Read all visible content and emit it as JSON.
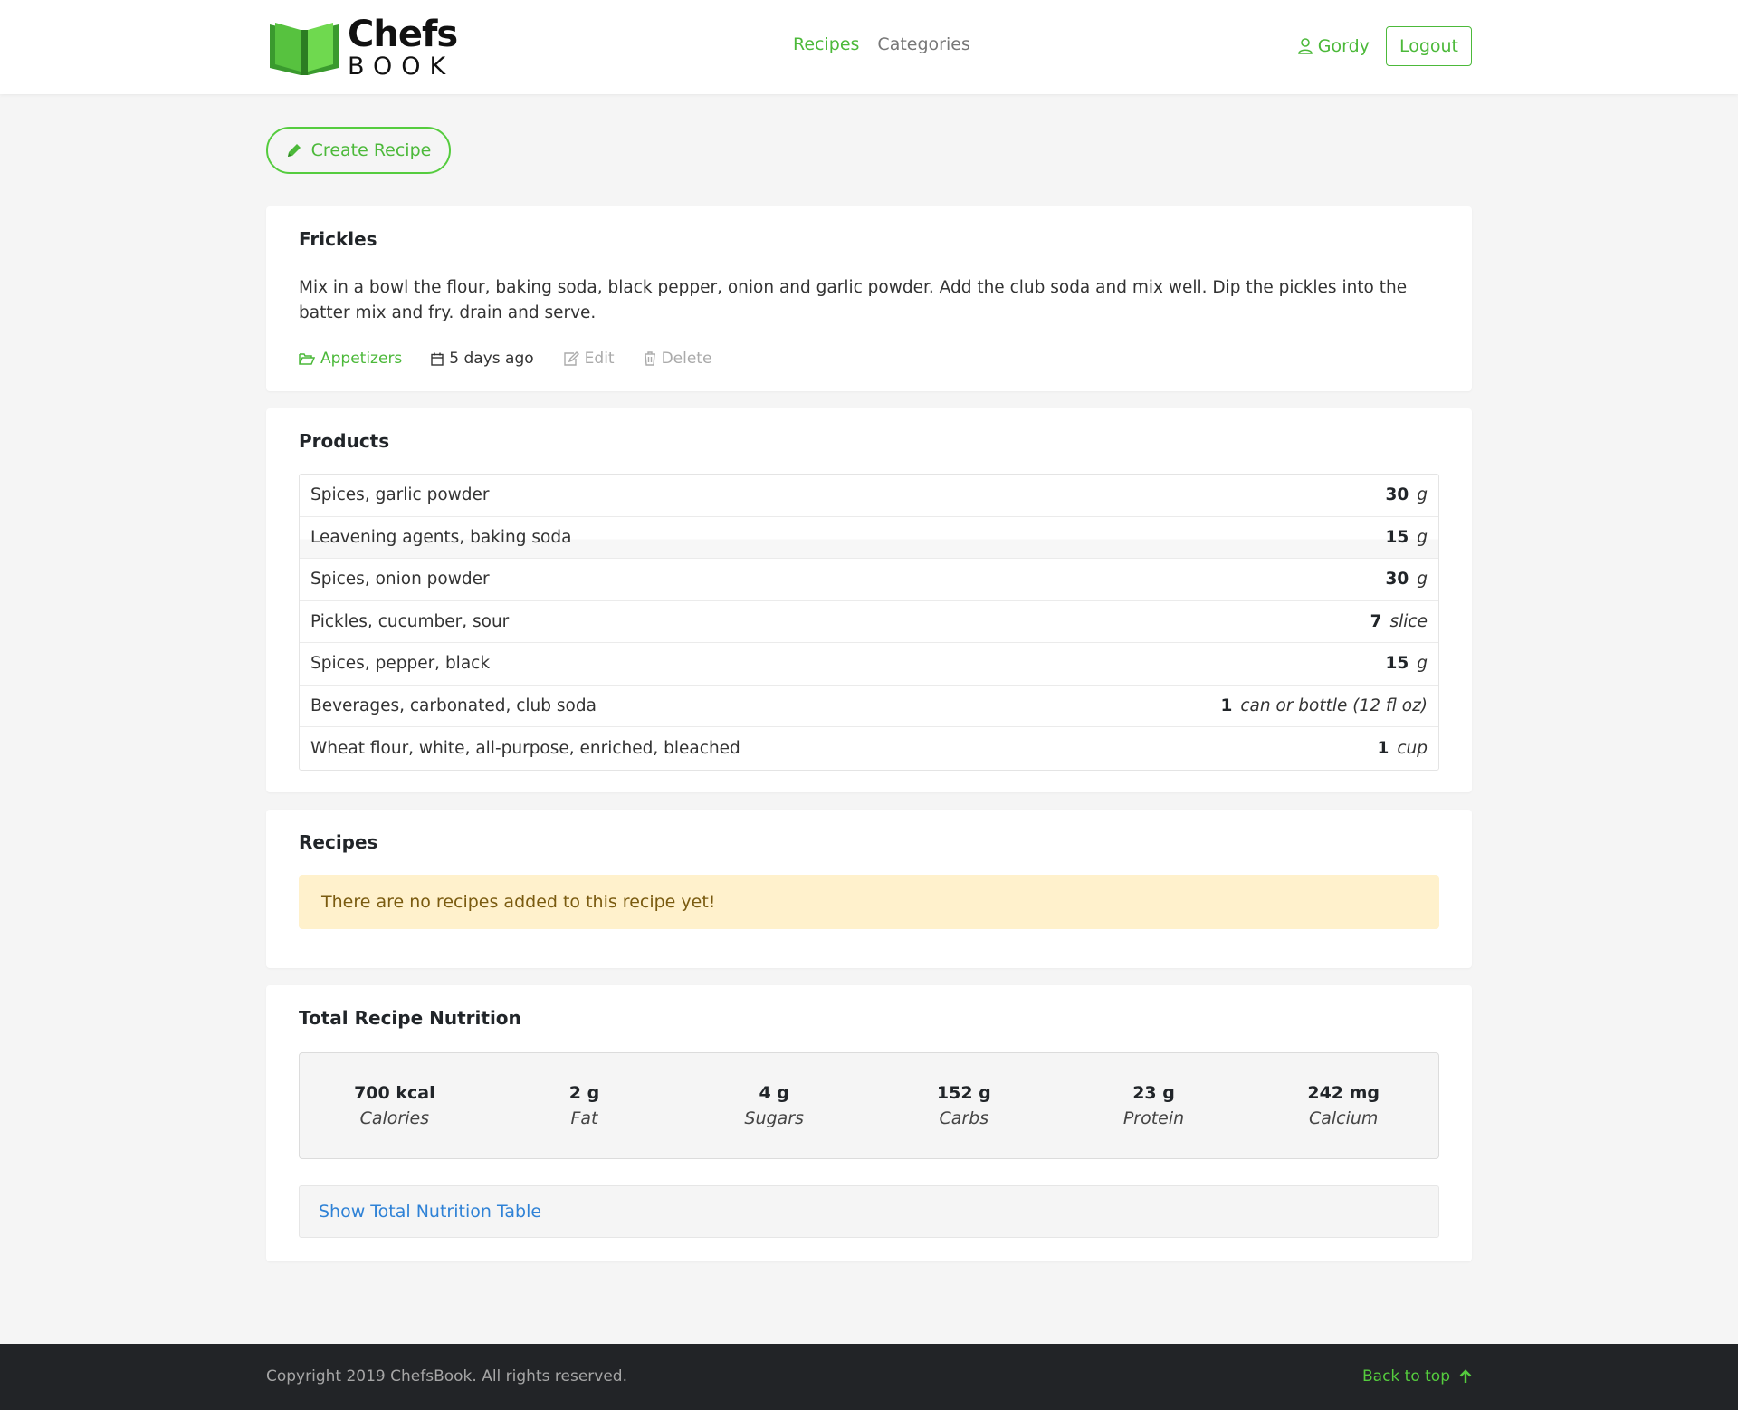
{
  "brand": {
    "name_top": "Chefs",
    "name_bottom": "BOOK",
    "colors": {
      "accent": "#4cb93a",
      "book_dark": "#3a9a2e"
    }
  },
  "nav": {
    "recipes": "Recipes",
    "categories": "Categories"
  },
  "user": {
    "name": "Gordy",
    "logout": "Logout"
  },
  "actions": {
    "create_recipe": "Create Recipe"
  },
  "recipe": {
    "title": "Frickles",
    "description": "Mix in a bowl the flour, baking soda, black pepper, onion and garlic powder. Add the club soda and mix well. Dip the pickles into the batter mix and fry. drain and serve.",
    "category": "Appetizers",
    "created": "5 days ago",
    "edit": "Edit",
    "delete": "Delete"
  },
  "products": {
    "title": "Products",
    "rows": [
      {
        "name": "Spices, garlic powder",
        "qty": "30",
        "unit": "g"
      },
      {
        "name": "Leavening agents, baking soda",
        "qty": "15",
        "unit": "g"
      },
      {
        "name": "Spices, onion powder",
        "qty": "30",
        "unit": "g"
      },
      {
        "name": "Pickles, cucumber, sour",
        "qty": "7",
        "unit": "slice"
      },
      {
        "name": "Spices, pepper, black",
        "qty": "15",
        "unit": "g"
      },
      {
        "name": "Beverages, carbonated, club soda",
        "qty": "1",
        "unit": "can or bottle (12 fl oz)"
      },
      {
        "name": "Wheat flour, white, all-purpose, enriched, bleached",
        "qty": "1",
        "unit": "cup"
      }
    ]
  },
  "recipes_section": {
    "title": "Recipes",
    "empty_message": "There are no recipes added to this recipe yet!"
  },
  "nutrition": {
    "title": "Total Recipe Nutrition",
    "items": [
      {
        "value": "700 kcal",
        "label": "Calories"
      },
      {
        "value": "2 g",
        "label": "Fat"
      },
      {
        "value": "4 g",
        "label": "Sugars"
      },
      {
        "value": "152 g",
        "label": "Carbs"
      },
      {
        "value": "23 g",
        "label": "Protein"
      },
      {
        "value": "242 mg",
        "label": "Calcium"
      }
    ],
    "toggle": "Show Total Nutrition Table"
  },
  "footer": {
    "copyright": "Copyright 2019 ChefsBook. All rights reserved.",
    "back_to_top": "Back to top"
  }
}
